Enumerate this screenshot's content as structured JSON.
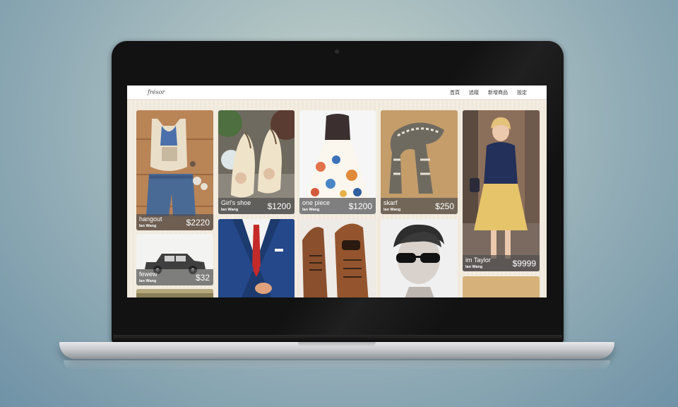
{
  "app": {
    "logo": "frésor"
  },
  "nav": {
    "items": [
      {
        "label": "首頁"
      },
      {
        "label": "追蹤"
      },
      {
        "label": "新增商品"
      },
      {
        "label": "設定"
      }
    ]
  },
  "products": [
    {
      "title": "hangout",
      "user": "Ian Wang",
      "price": "$2220",
      "image": "outfit-flatlay-image"
    },
    {
      "title": "Girl's shoe",
      "user": "Ian Wang",
      "price": "$1200",
      "image": "lace-shoes-image"
    },
    {
      "title": "one piece",
      "user": "Ian Wang",
      "price": "$1200",
      "image": "floral-dress-image"
    },
    {
      "title": "skarf",
      "user": "Ian Wang",
      "price": "$250",
      "image": "knit-scarf-image"
    },
    {
      "title": "im Taylor",
      "user": "Ian Wang",
      "price": "$9999",
      "image": "street-style-image"
    },
    {
      "title": "fewew",
      "user": "Ian Wang",
      "price": "$32",
      "image": "vintage-car-image"
    }
  ],
  "uncaptioned_images": [
    "suit-tie-image",
    "leather-boots-image",
    "sunglasses-portrait-image"
  ],
  "colors": {
    "caption_bg": "#505050",
    "screen_bg": "#f2ece0",
    "bezel": "#121212"
  }
}
